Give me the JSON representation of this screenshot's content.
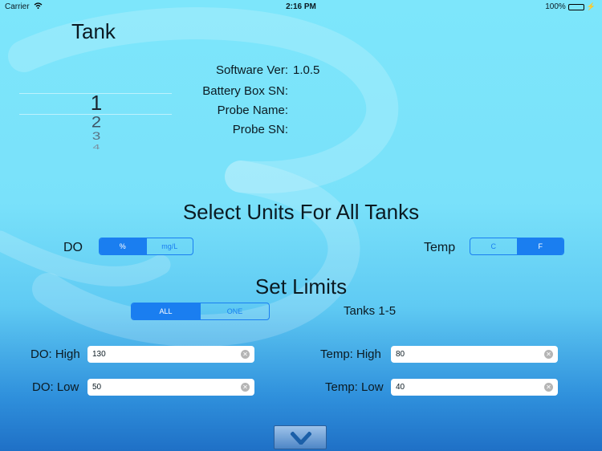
{
  "status": {
    "carrier": "Carrier",
    "time": "2:16 PM",
    "battery": "100%",
    "icons": [
      "wifi-icon",
      "battery-icon",
      "charging-icon"
    ]
  },
  "title": "Tank",
  "info": {
    "software_label": "Software Ver:",
    "software_value": "1.0.5",
    "battery_label": "Battery Box SN:",
    "battery_value": "",
    "probe_name_label": "Probe Name:",
    "probe_name_value": "",
    "probe_sn_label": "Probe SN:",
    "probe_sn_value": ""
  },
  "picker": {
    "selected": "1",
    "items": [
      "1",
      "2",
      "3",
      "4"
    ]
  },
  "units": {
    "heading": "Select Units For All Tanks",
    "do_label": "DO",
    "do_options": [
      "%",
      "mg/L"
    ],
    "do_selected": "%",
    "temp_label": "Temp",
    "temp_options": [
      "C",
      "F"
    ],
    "temp_selected": "F"
  },
  "limits": {
    "heading": "Set Limits",
    "scope_options": [
      "ALL",
      "ONE"
    ],
    "scope_selected": "ALL",
    "tanks_text": "Tanks 1-5",
    "do_high_label": "DO: High",
    "do_high_value": "130",
    "do_low_label": "DO: Low",
    "do_low_value": "50",
    "temp_high_label": "Temp: High",
    "temp_high_value": "80",
    "temp_low_label": "Temp: Low",
    "temp_low_value": "40"
  },
  "colors": {
    "accent": "#1a7ef0",
    "background_top": "#7de6fb",
    "background_bottom": "#1f70c6"
  },
  "down_button_icon": "chevron-down-icon"
}
